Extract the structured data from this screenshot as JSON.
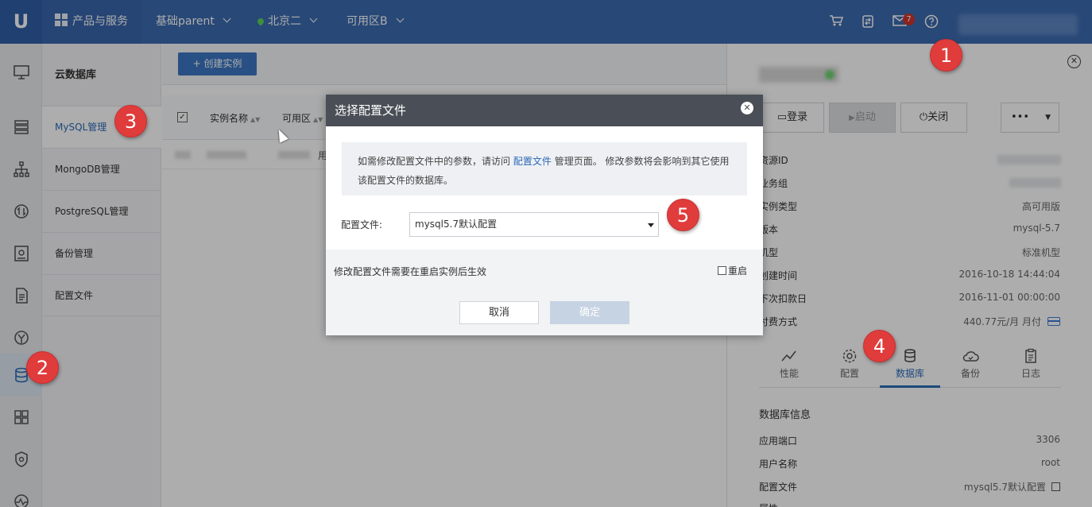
{
  "topbar": {
    "logo": "U",
    "products": "产品与服务",
    "project": "基础parent",
    "region": "北京二",
    "zone": "可用区B",
    "message_count": "7"
  },
  "subnav": {
    "title": "云数据库",
    "items": [
      "MySQL管理",
      "MongoDB管理",
      "PostgreSQL管理",
      "备份管理",
      "配置文件"
    ]
  },
  "main": {
    "create_button": "+ 创建实例",
    "columns": [
      "实例名称",
      "可用区"
    ],
    "partial_cell": "用"
  },
  "detail": {
    "buttons": {
      "login": "登录",
      "start": "启动",
      "stop": "关闭",
      "more": "•••"
    },
    "rows": [
      {
        "label": "资源ID",
        "value": ""
      },
      {
        "label": "业务组",
        "value": ""
      },
      {
        "label": "实例类型",
        "value": "高可用版"
      },
      {
        "label": "版本",
        "value": "mysql-5.7"
      },
      {
        "label": "机型",
        "value": "标准机型"
      },
      {
        "label": "创建时间",
        "value": "2016-10-18 14:44:04"
      },
      {
        "label": "下次扣款日",
        "value": "2016-11-01 00:00:00"
      },
      {
        "label": "付费方式",
        "value": "440.77元/月 月付"
      }
    ],
    "tabs": [
      "性能",
      "配置",
      "数据库",
      "备份",
      "日志"
    ],
    "db_section": "数据库信息",
    "db_rows": [
      {
        "label": "应用端口",
        "value": "3306"
      },
      {
        "label": "用户名称",
        "value": "root"
      },
      {
        "label": "配置文件",
        "value": "mysql5.7默认配置"
      },
      {
        "label": "属性",
        "value": ""
      }
    ]
  },
  "modal": {
    "title": "选择配置文件",
    "notice_before": "如需修改配置文件中的参数，请访问",
    "notice_link": "配置文件",
    "notice_after": "管理页面。 修改参数将会影响到其它使用该配置文件的数据库。",
    "field_label": "配置文件:",
    "select_value": "mysql5.7默认配置",
    "tip": "修改配置文件需要在重启实例后生效",
    "restart_label": "重启",
    "cancel": "取消",
    "confirm": "确定"
  },
  "markers": [
    "1",
    "2",
    "3",
    "4",
    "5"
  ],
  "colors": {
    "topbar": "#3c6ab0",
    "accent": "#2c6ab8",
    "marker": "#e03c3c",
    "modal_header": "#4a4f57"
  }
}
